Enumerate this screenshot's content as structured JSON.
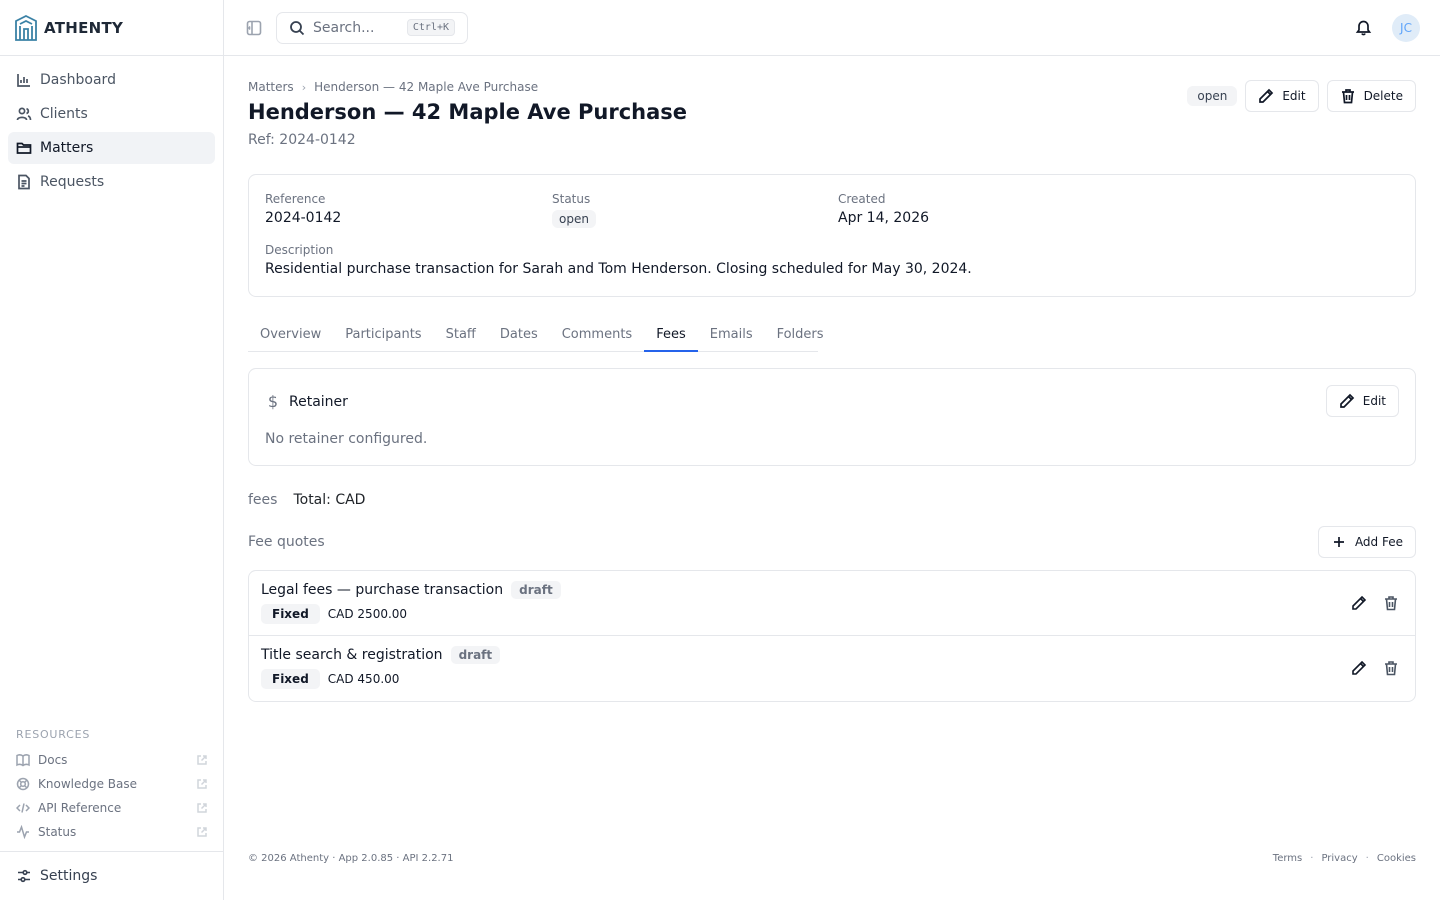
{
  "brand": {
    "name": "ATHENTY"
  },
  "sidebar": {
    "items": [
      {
        "label": "Dashboard",
        "icon": "chart-icon"
      },
      {
        "label": "Clients",
        "icon": "users-icon"
      },
      {
        "label": "Matters",
        "icon": "folder-icon",
        "active": true
      },
      {
        "label": "Requests",
        "icon": "document-icon"
      }
    ],
    "resources_title": "RESOURCES",
    "resources": [
      {
        "label": "Docs",
        "icon": "book-icon"
      },
      {
        "label": "Knowledge Base",
        "icon": "lifebuoy-icon"
      },
      {
        "label": "API Reference",
        "icon": "code-icon"
      },
      {
        "label": "Status",
        "icon": "activity-icon"
      }
    ],
    "settings_label": "Settings"
  },
  "topbar": {
    "search_placeholder": "Search...",
    "search_shortcut": "Ctrl+K",
    "avatar_initials": "JC"
  },
  "breadcrumb": {
    "root": "Matters",
    "current": "Henderson — 42 Maple Ave Purchase"
  },
  "matter": {
    "title": "Henderson — 42 Maple Ave Purchase",
    "ref_line": "Ref: 2024-0142",
    "status": "open",
    "edit_label": "Edit",
    "delete_label": "Delete"
  },
  "info": {
    "reference_label": "Reference",
    "reference_value": "2024-0142",
    "status_label": "Status",
    "status_value": "open",
    "created_label": "Created",
    "created_value": "Apr 14, 2026",
    "description_label": "Description",
    "description_value": "Residential purchase transaction for Sarah and Tom Henderson. Closing scheduled for May 30, 2024."
  },
  "tabs": [
    "Overview",
    "Participants",
    "Staff",
    "Dates",
    "Comments",
    "Fees",
    "Emails",
    "Folders"
  ],
  "active_tab": "Fees",
  "retainer": {
    "title": "Retainer",
    "edit_label": "Edit",
    "empty_text": "No retainer configured."
  },
  "fees": {
    "label": "fees",
    "total": "Total: CAD",
    "quotes_label": "Fee quotes",
    "add_label": "Add Fee",
    "items": [
      {
        "name": "Legal fees — purchase transaction",
        "status": "draft",
        "type": "Fixed",
        "amount": "CAD 2500.00"
      },
      {
        "name": "Title search & registration",
        "status": "draft",
        "type": "Fixed",
        "amount": "CAD 450.00"
      }
    ]
  },
  "footer": {
    "left": "© 2026 Athenty · App 2.0.85 · API 2.2.71",
    "links": [
      "Terms",
      "Privacy",
      "Cookies"
    ],
    "separator": "·"
  },
  "colors": {
    "accent": "#2563eb",
    "border": "#e5e7eb",
    "logo": "#3b82a6"
  }
}
